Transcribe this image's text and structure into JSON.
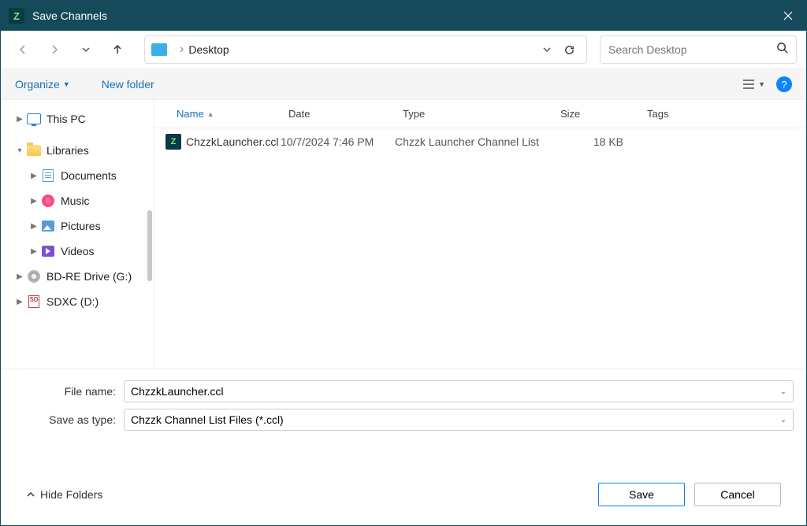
{
  "window": {
    "title": "Save Channels"
  },
  "address": {
    "location": "Desktop"
  },
  "search": {
    "placeholder": "Search Desktop"
  },
  "toolbar": {
    "organize": "Organize",
    "new_folder": "New folder"
  },
  "sidebar": {
    "this_pc": "This PC",
    "libraries": "Libraries",
    "documents": "Documents",
    "music": "Music",
    "pictures": "Pictures",
    "videos": "Videos",
    "bdre": "BD-RE Drive (G:)",
    "sdxc": "SDXC (D:)"
  },
  "columns": {
    "name": "Name",
    "date": "Date",
    "type": "Type",
    "size": "Size",
    "tags": "Tags"
  },
  "files": [
    {
      "name": "ChzzkLauncher.ccl",
      "date": "10/7/2024 7:46 PM",
      "type": "Chzzk Launcher Channel List",
      "size": "18 KB"
    }
  ],
  "form": {
    "filename_label": "File name:",
    "filename_value": "ChzzkLauncher.ccl",
    "savetype_label": "Save as type:",
    "savetype_value": "Chzzk Channel List Files (*.ccl)"
  },
  "actions": {
    "hide_folders": "Hide Folders",
    "save": "Save",
    "cancel": "Cancel"
  }
}
